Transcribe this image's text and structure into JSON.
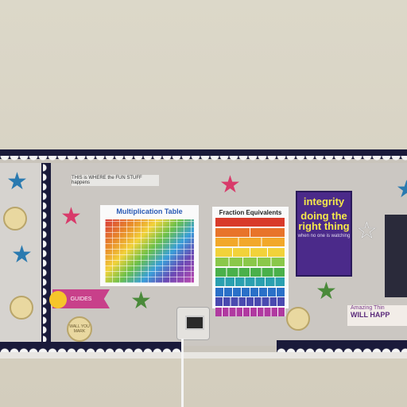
{
  "scene": "classroom-bulletin-board",
  "signs": {
    "fun_stuff": "THIS is WHERE the FUN STUFF happens"
  },
  "posters": {
    "multiplication_title": "Multiplication Table",
    "fractions_title": "Fraction Equivalents",
    "integrity_word": "integrity",
    "integrity_line1": "doing the right thing",
    "integrity_line2": "when no one is watching",
    "amazing_line1": "Amazing Thin",
    "amazing_line2": "WILL HAPP",
    "sun_banner": "GUIDES",
    "badge_left": "WALL YOU MARK"
  },
  "colors": {
    "board_border": "#1a1a3a",
    "star_blue": "#2a7ab0",
    "star_pink": "#d83a6a",
    "star_green": "#4a8a3a",
    "integrity_bg": "#4b2a8a"
  },
  "fraction_colors": [
    "#d83a2a",
    "#e8742a",
    "#f2a82a",
    "#f2d23a",
    "#8ac84a",
    "#4ab04a",
    "#2aa0b0",
    "#2a70c8",
    "#4a4ab0",
    "#b03aa0"
  ]
}
